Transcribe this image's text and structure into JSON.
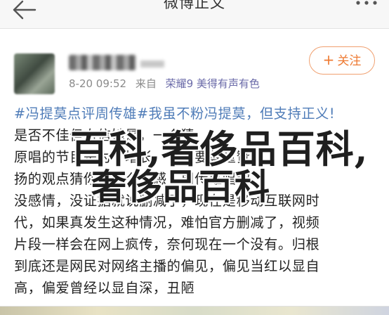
{
  "nav": {
    "title": "微博正文",
    "back_icon": "back-arrow-icon",
    "more_icon": "more-dots-icon"
  },
  "post": {
    "time": "8-20 09:52",
    "source_prefix": "来自",
    "source": "荣耀9 美得有声有色",
    "follow_label": "关注",
    "follow_plus": "+",
    "lines": [
      {
        "topic": "#冯提莫点评周传雄",
        "text": "#我虽不粉冯提莫，但支持正义!"
      },
      {
        "topic": "",
        "text": "是否不佳但自信她是，一个猜"
      },
      {
        "topic": "",
        "text": "原唱的节目是为了增长，作为要尊重赞"
      },
      {
        "topic": "",
        "text": "扬的观点猜你有什么能感，周传雄唱歌"
      },
      {
        "topic": "",
        "text": "没感情，没证据就说删减了，现在是移动互联网时"
      },
      {
        "topic": "",
        "text": "代，如果真发生这种情况，难怕官方删减了，视频"
      },
      {
        "topic": "",
        "text": "片段一样会在网上疯传，奈何现在一个没有。归根"
      },
      {
        "topic": "",
        "text": "到底还是网民对网络主播的偏见，偏见当红以显自"
      },
      {
        "topic": "",
        "text": "高，偏爱曾经以显自深，丑陋"
      }
    ]
  },
  "watermark": {
    "line1": "百科,奢侈品百科,",
    "line2": "奢侈品百科"
  }
}
